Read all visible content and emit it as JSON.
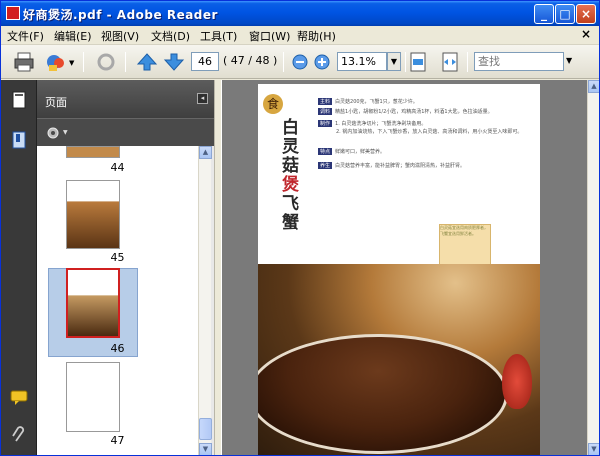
{
  "window": {
    "title": "好商煲汤.pdf - Adobe Reader",
    "min_label": "_",
    "max_label": "□",
    "close_label": "×"
  },
  "menubar": {
    "items": [
      "文件(F)",
      "编辑(E)",
      "视图(V)",
      "文档(D)",
      "工具(T)",
      "窗口(W)",
      "帮助(H)"
    ],
    "close_label": "×"
  },
  "toolbar": {
    "current_page": "46",
    "page_count": "( 47 / 48 )",
    "zoom": "13.1%",
    "zoom_arrow": "▼",
    "search_placeholder": "查找",
    "search_arrow": "▼"
  },
  "panel": {
    "title": "页面",
    "options_label": "◂",
    "thumbnails": [
      {
        "label": "44"
      },
      {
        "label": "45"
      },
      {
        "label": "46",
        "selected": true
      },
      {
        "label": "47"
      }
    ]
  },
  "scrollbar": {
    "up": "▲",
    "down": "▼"
  },
  "document": {
    "seal": "食",
    "title_top": "白灵菇",
    "title_red": "煲",
    "title_bottom": "飞蟹",
    "rows": [
      {
        "tag": "主料",
        "text": "白灵菇200克，飞蟹1只，葱花少许。"
      },
      {
        "tag": "调料",
        "text": "精盐1小匙，胡椒粉1/2小匙，鸡精高汤1杯，料酒1大匙，色拉油适量。"
      },
      {
        "tag": "制作",
        "text": "1. 白灵菇洗净切片；飞蟹洗净剁块备用。"
      },
      {
        "tag": "",
        "text": "2. 锅内加油烧热，下入飞蟹炒香，放入白灵菇、高汤和调料，用小火煲至入味即可。"
      },
      {
        "tag": "特点",
        "text": "鲜嫩可口，鲜美营养。"
      },
      {
        "tag": "养生",
        "text": "白灵菇营养丰富，能补益脾胃；蟹肉滋阴清热，补益肝肾。"
      }
    ],
    "note": "白灵菇宜选用肉质肥厚者，飞蟹宜选用鲜活者。"
  }
}
